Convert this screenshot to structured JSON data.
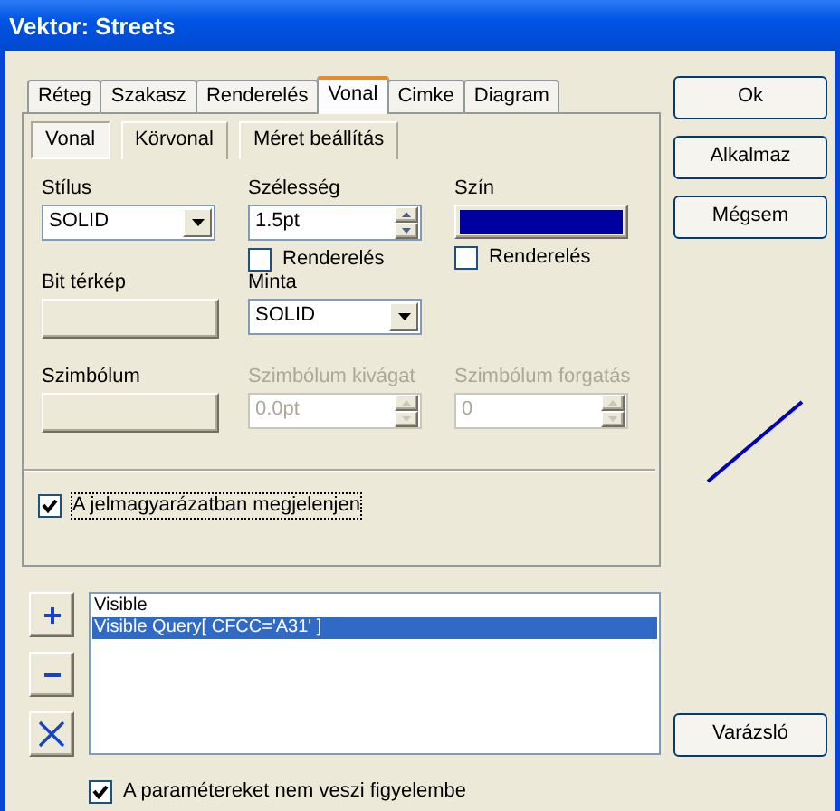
{
  "window": {
    "title": "Vektor: Streets"
  },
  "tabs": [
    {
      "label": "Réteg",
      "selected": false
    },
    {
      "label": "Szakasz",
      "selected": false
    },
    {
      "label": "Renderelés",
      "selected": false
    },
    {
      "label": "Vonal",
      "selected": true
    },
    {
      "label": "Cimke",
      "selected": false
    },
    {
      "label": "Diagram",
      "selected": false
    }
  ],
  "subtabs": [
    {
      "label": "Vonal",
      "selected": true
    },
    {
      "label": "Körvonal",
      "selected": false
    },
    {
      "label": "Méret beállítás",
      "selected": false
    }
  ],
  "fields": [
    {
      "kind": "combo",
      "label": "Stílus",
      "value": "SOLID",
      "disabled": false
    },
    {
      "kind": "spinner",
      "label": "Szélesség",
      "value": "1.5pt",
      "disabled": false,
      "checkbox": {
        "label": "Renderelés",
        "checked": false
      }
    },
    {
      "kind": "color",
      "label": "Szín",
      "color": "#0000a0",
      "disabled": false,
      "checkbox": {
        "label": "Renderelés",
        "checked": false
      }
    },
    {
      "kind": "button",
      "label": "Bit térkép",
      "disabled": false
    },
    {
      "kind": "combo",
      "label": "Minta",
      "value": "SOLID",
      "disabled": false
    },
    {
      "kind": "blank"
    },
    {
      "kind": "button",
      "label": "Szimbólum",
      "disabled": false
    },
    {
      "kind": "spinner",
      "label": "Szimbólum kivágat",
      "value": "0.0pt",
      "disabled": true
    },
    {
      "kind": "spinner",
      "label": "Szimbólum forgatás",
      "value": "0",
      "disabled": true
    }
  ],
  "legend_checkbox": {
    "label": "A jelmagyarázatban megjelenjen",
    "checked": true
  },
  "buttons": [
    "Ok",
    "Alkalmaz",
    "Mégsem"
  ],
  "queries": [
    {
      "label": "Visible",
      "selected": false
    },
    {
      "label": "Visible Query[ CFCC='A31' ]",
      "selected": true
    }
  ],
  "wizard_button": "Varázsló",
  "ignore_checkbox": {
    "label": "A paramétereket nem veszi figyelembe",
    "checked": true
  }
}
